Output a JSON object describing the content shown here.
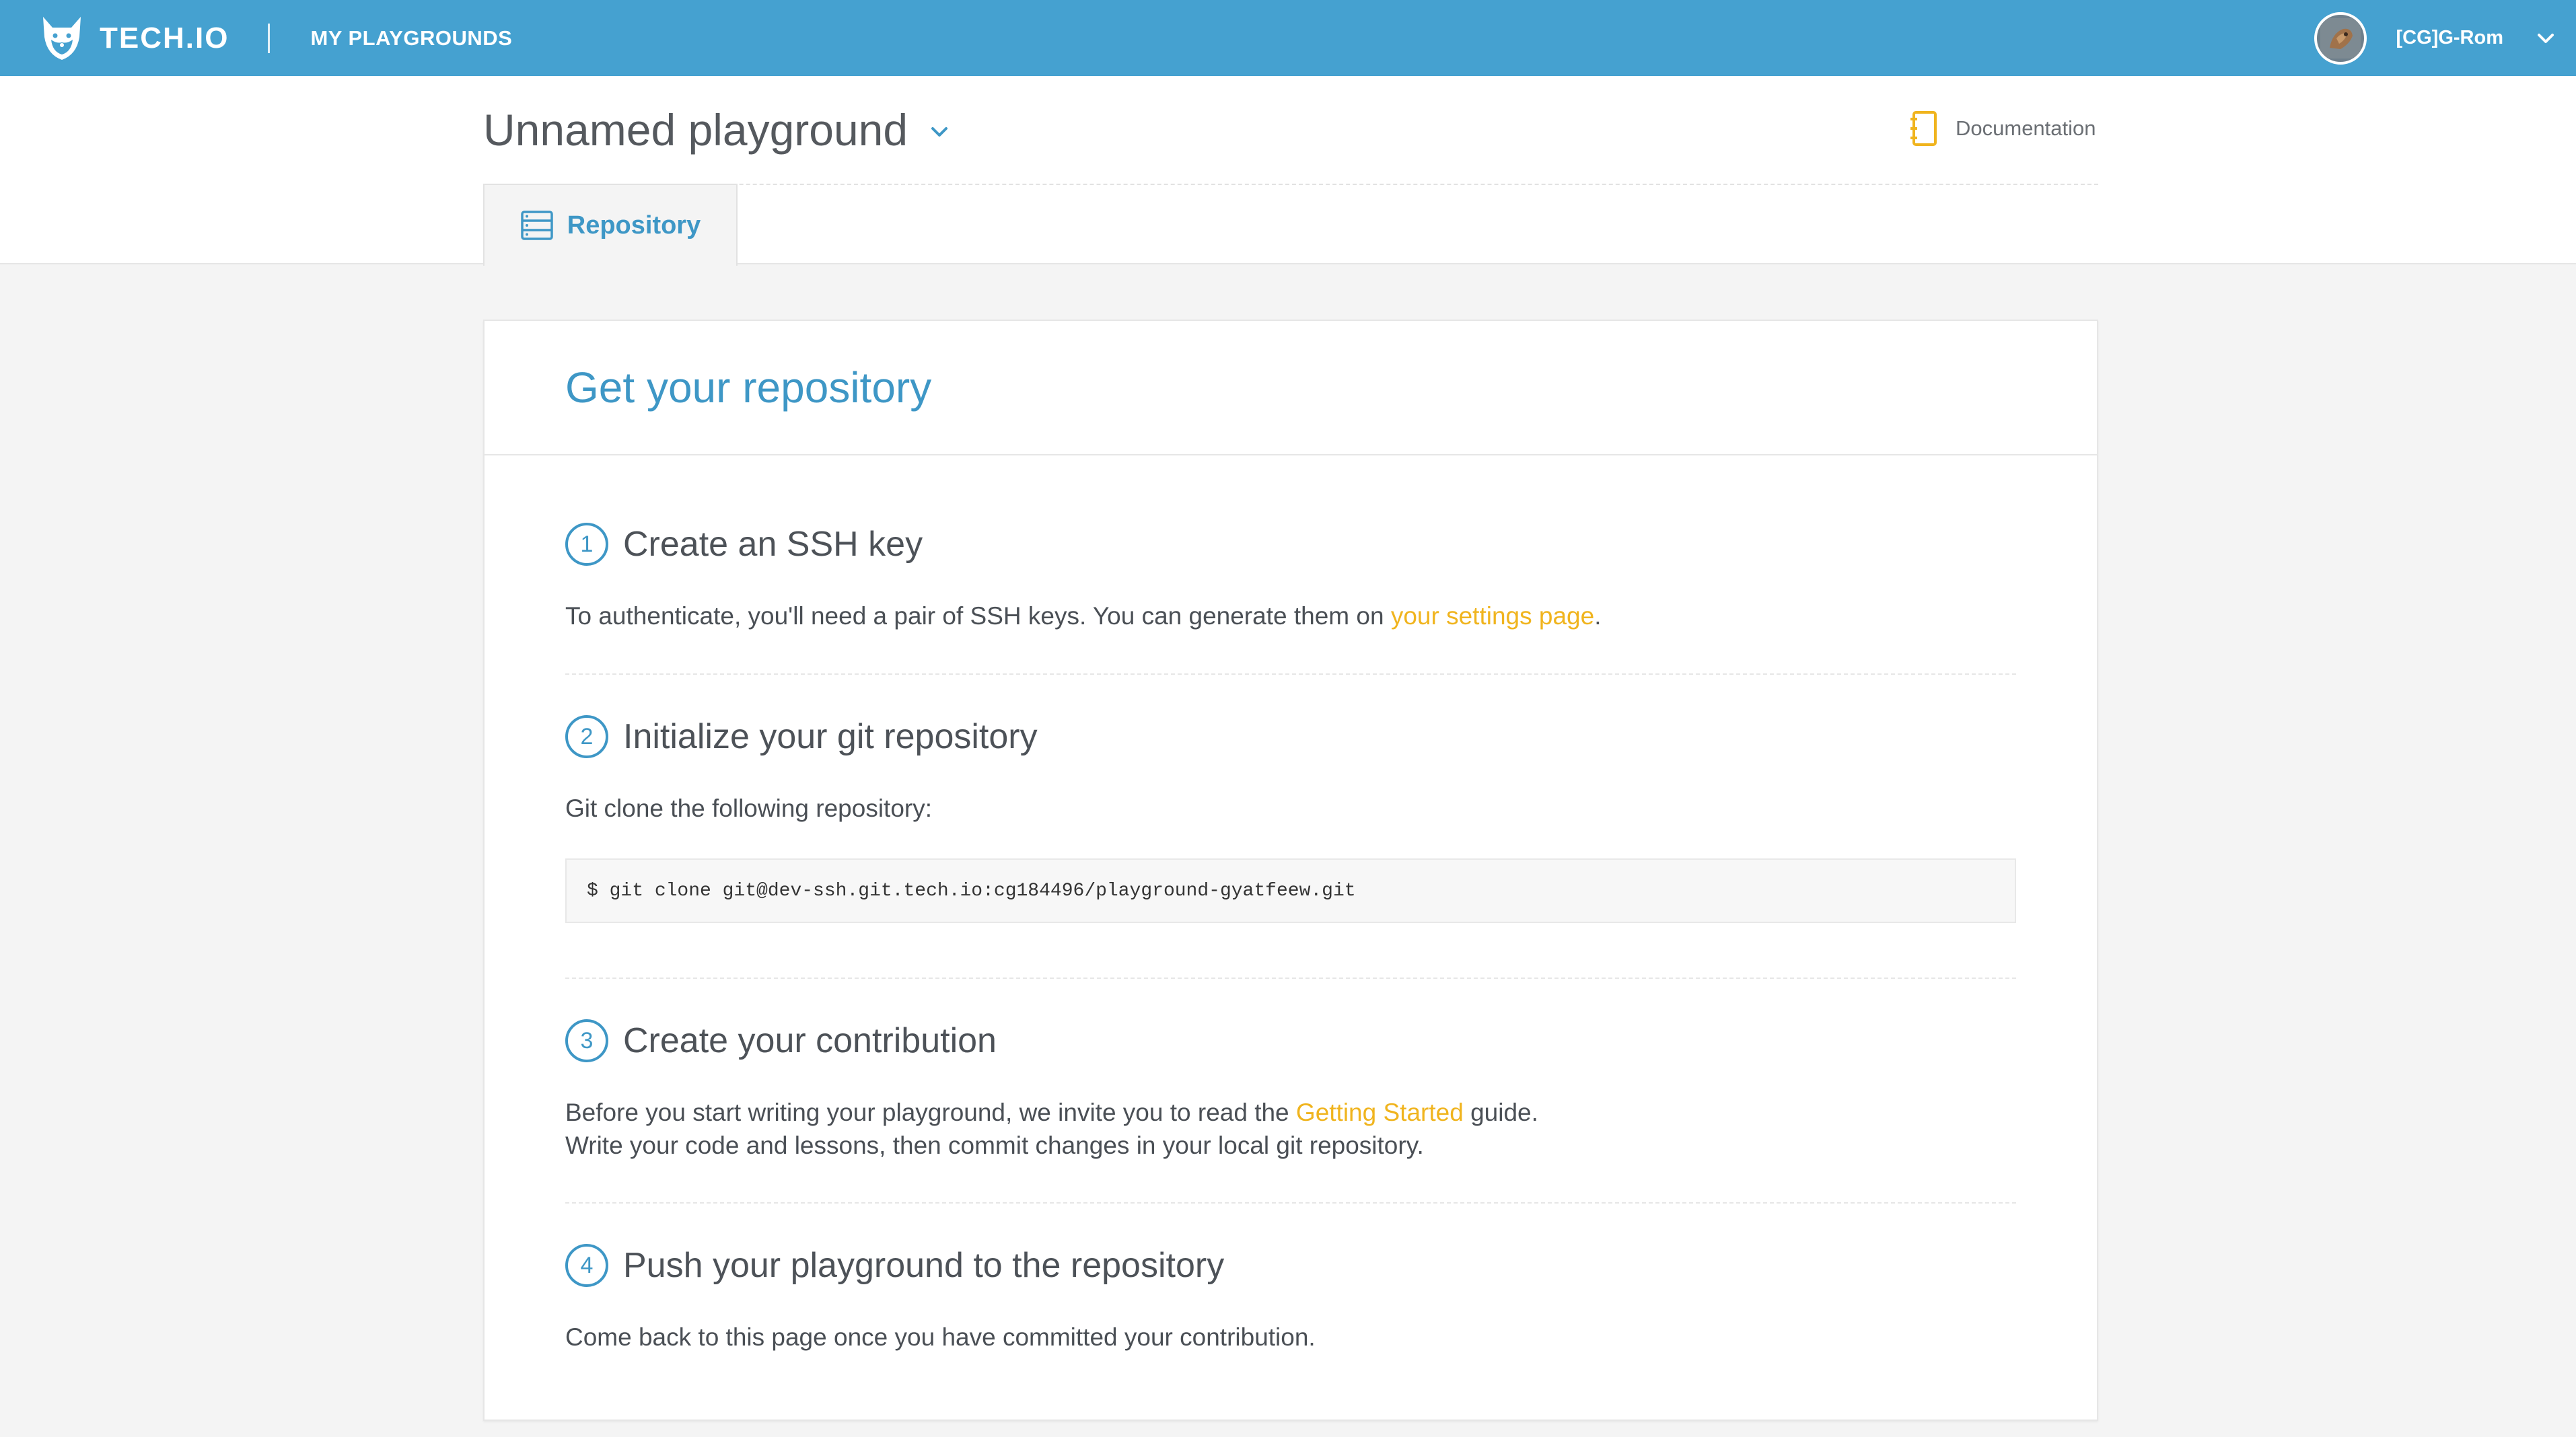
{
  "topnav": {
    "brand": "TECH.IO",
    "my_playgrounds": "MY PLAYGROUNDS",
    "username": "[CG]G-Rom"
  },
  "header": {
    "title": "Unnamed playground",
    "documentation": "Documentation",
    "tab_repository": "Repository"
  },
  "card": {
    "title": "Get your repository",
    "steps": [
      {
        "num": "1",
        "title": "Create an SSH key",
        "text_before": "To authenticate, you'll need a pair of SSH keys. You can generate them on ",
        "link": "your settings page",
        "text_after": "."
      },
      {
        "num": "2",
        "title": "Initialize your git repository",
        "text": "Git clone the following repository:",
        "code": "$ git clone git@dev-ssh.git.tech.io:cg184496/playground-gyatfeew.git"
      },
      {
        "num": "3",
        "title": "Create your contribution",
        "text_before": "Before you start writing your playground, we invite you to read the ",
        "link": "Getting Started",
        "text_after": " guide.",
        "text_line2": "Write your code and lessons, then commit changes in your local git repository."
      },
      {
        "num": "4",
        "title": "Push your playground to the repository",
        "text": "Come back to this page once you have committed your contribution."
      }
    ]
  },
  "colors": {
    "nav_bg": "#45a1d0",
    "accent_blue": "#3e97c6",
    "link_yellow": "#f0b41e"
  },
  "icons": {
    "logo": "fox-logo-icon",
    "avatar": "user-avatar",
    "user_menu": "chevron-down-icon",
    "title_menu": "chevron-down-icon",
    "documentation": "notebook-icon",
    "repository": "server-icon"
  }
}
